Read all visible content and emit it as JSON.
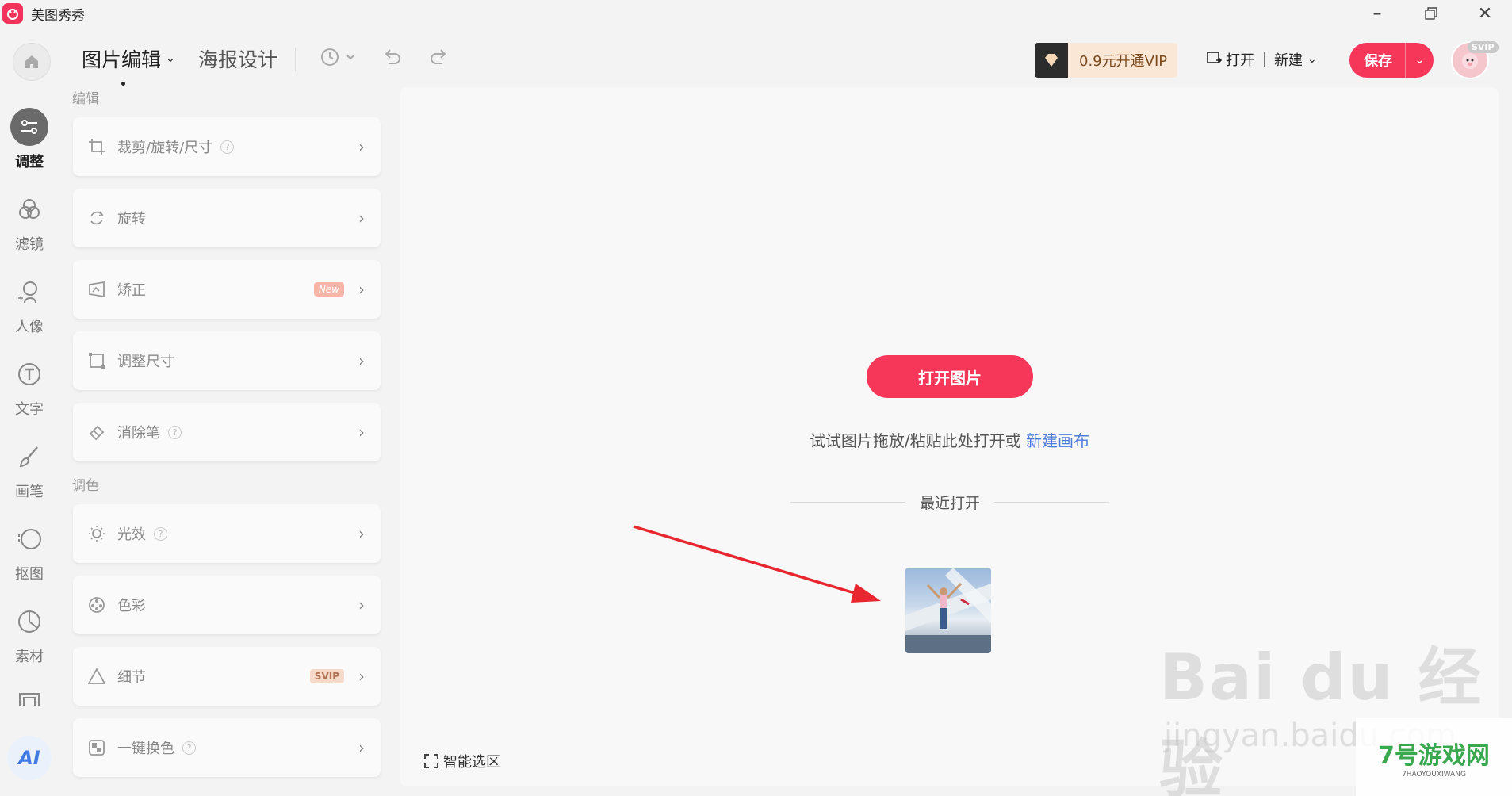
{
  "titlebar": {
    "app_name": "美图秀秀"
  },
  "toolbar": {
    "tabs": [
      {
        "label": "图片编辑"
      },
      {
        "label": "海报设计"
      }
    ],
    "vip_label": "0.9元开通VIP",
    "open_label": "打开",
    "new_label": "新建",
    "save_label": "保存",
    "svip_badge": "SVIP"
  },
  "rail": {
    "items": [
      {
        "label": "调整",
        "icon": "adjust-icon"
      },
      {
        "label": "滤镜",
        "icon": "filter-icon"
      },
      {
        "label": "人像",
        "icon": "portrait-icon"
      },
      {
        "label": "文字",
        "icon": "text-icon"
      },
      {
        "label": "画笔",
        "icon": "brush-icon"
      },
      {
        "label": "抠图",
        "icon": "cutout-icon"
      },
      {
        "label": "素材",
        "icon": "sticker-icon"
      }
    ],
    "ai_label": "AI"
  },
  "panel": {
    "section_edit": "编辑",
    "section_color": "调色",
    "items": [
      {
        "label": "裁剪/旋转/尺寸",
        "icon": "crop-icon",
        "help": true
      },
      {
        "label": "旋转",
        "icon": "rotate-icon"
      },
      {
        "label": "矫正",
        "icon": "correct-icon",
        "tag": "New"
      },
      {
        "label": "调整尺寸",
        "icon": "resize-icon"
      },
      {
        "label": "消除笔",
        "icon": "eraser-icon",
        "help": true
      },
      {
        "label": "光效",
        "icon": "light-icon",
        "help": true
      },
      {
        "label": "色彩",
        "icon": "color-icon"
      },
      {
        "label": "细节",
        "icon": "detail-icon",
        "tag": "SVIP"
      },
      {
        "label": "一键换色",
        "icon": "recolor-icon",
        "help": true
      }
    ]
  },
  "canvas": {
    "open_button": "打开图片",
    "hint_text": "试试图片拖放/粘贴此处打开或",
    "hint_link": "新建画布",
    "recent_title": "最近打开",
    "smart_select": "智能选区"
  },
  "watermark": {
    "baidu": "Bai du 经验",
    "url": "jingyan.baidu.com",
    "site": "7号游戏网",
    "site_sub": "7HAOYOUXIWANG"
  },
  "colors": {
    "accent": "#f7375a",
    "link": "#4c7bd8"
  }
}
